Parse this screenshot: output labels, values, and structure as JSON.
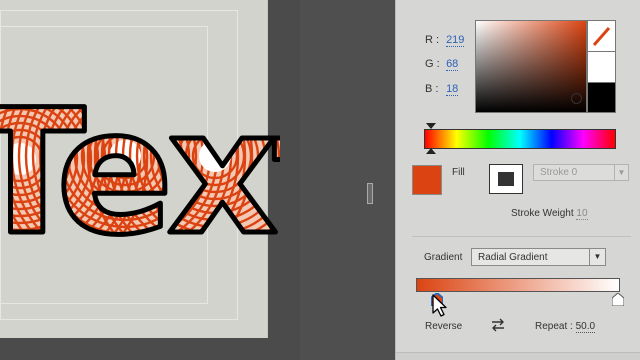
{
  "canvas": {
    "text": "Text",
    "fill_color": "#db4412",
    "stroke_color": "#000000"
  },
  "color": {
    "r_label": "R :",
    "r_value": "219",
    "g_label": "G :",
    "g_value": "68",
    "b_label": "B :",
    "b_value": "18",
    "current_hex": "#db4412",
    "hue_fraction": 0.0
  },
  "fill": {
    "label": "Fill",
    "color": "#db4412"
  },
  "stroke": {
    "select_value": "Stroke 0",
    "weight_label": "Stroke Weight",
    "weight_value": "10"
  },
  "gradient": {
    "label": "Gradient",
    "type": "Radial Gradient",
    "start_color": "#db4412",
    "end_color": "#ffffff",
    "reverse_label": "Reverse",
    "repeat_label": "Repeat :",
    "repeat_value": "50.0"
  },
  "icons": {
    "picker_ring": "circle-icon",
    "none_swatch": "no-color-icon",
    "swap": "swap-icon",
    "cursor": "arrow-cursor-icon"
  }
}
